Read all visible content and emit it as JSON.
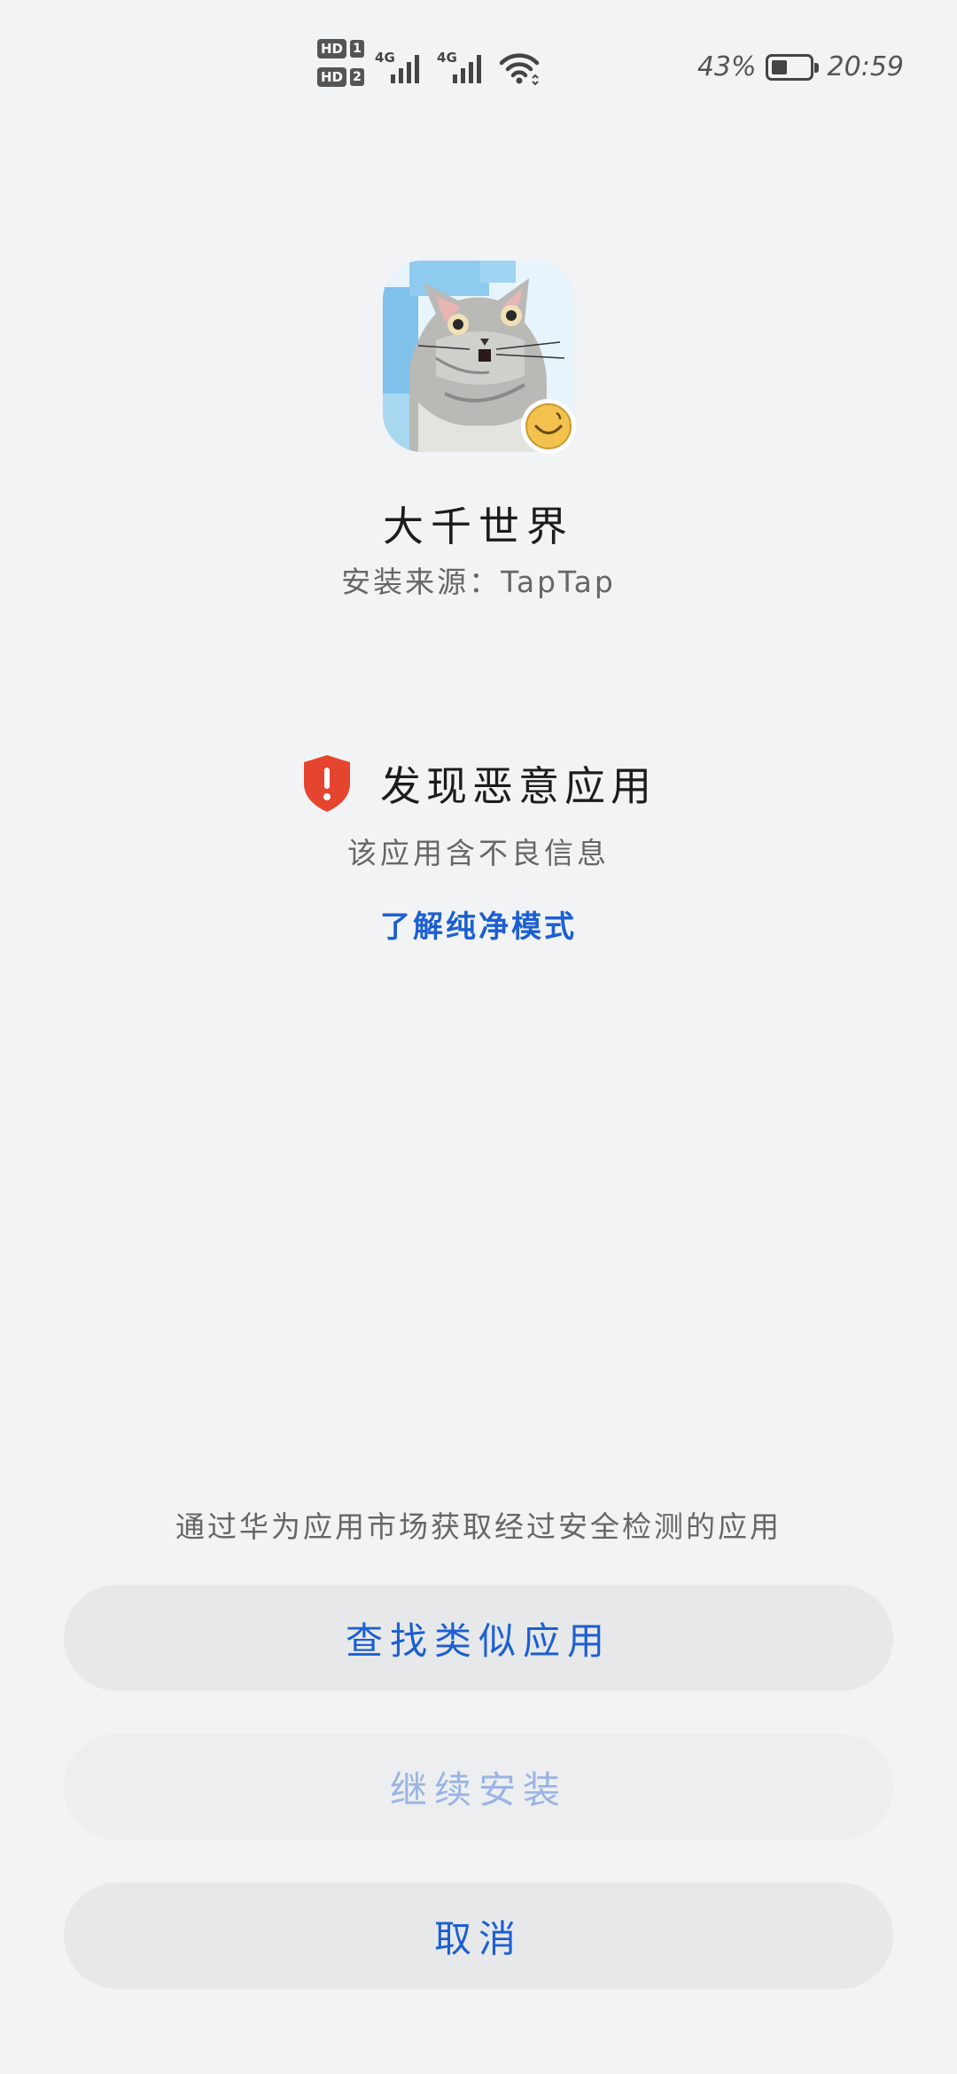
{
  "status_bar": {
    "sim1_label": "HD",
    "sim1_num": "1",
    "sim2_label": "HD",
    "sim2_num": "2",
    "net1": "4G",
    "net2": "4G",
    "battery_percent_text": "43%",
    "battery_level": 0.43,
    "time": "20:59"
  },
  "app": {
    "name": "大千世界",
    "install_source": "安装来源：TapTap"
  },
  "warning": {
    "title": "发现恶意应用",
    "description": "该应用含不良信息",
    "learn_more": "了解纯净模式",
    "icon": "shield-alert-icon",
    "icon_color": "#e5452f"
  },
  "recommend_text": "通过华为应用市场获取经过安全检测的应用",
  "buttons": {
    "find_similar": "查找类似应用",
    "continue_install": "继续安装",
    "cancel": "取消"
  },
  "colors": {
    "accent": "#1c5fd1",
    "background": "#f1f3f5",
    "button_bg": "#e6e8ea"
  }
}
